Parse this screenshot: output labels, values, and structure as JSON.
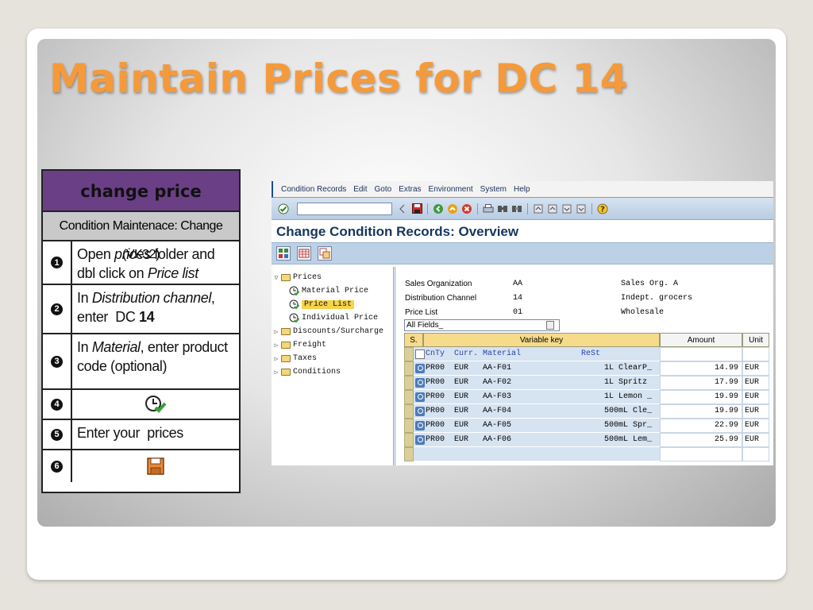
{
  "slide": {
    "title": "Maintain Prices for DC 14"
  },
  "steps": {
    "header": "change price",
    "subheader": "Condition Maintenace: Change (VK32)",
    "rows": [
      {
        "num": "1",
        "text_html": "Open <i>prices</i> folder and dbl click on <i>Price list</i>"
      },
      {
        "num": "2",
        "text_html": "In <i>Distribution channel</i>, enter &nbsp;DC <b>14</b>"
      },
      {
        "num": "3",
        "text_html": "In <i>Material</i>, enter product code (optional)"
      },
      {
        "num": "4",
        "icon": "execute-clock-check-icon"
      },
      {
        "num": "5",
        "text_html": "Enter your &nbsp;prices"
      },
      {
        "num": "6",
        "icon": "save-floppy-icon"
      }
    ]
  },
  "sap": {
    "menu": [
      "Condition Records",
      "Edit",
      "Goto",
      "Extras",
      "Environment",
      "System",
      "Help"
    ],
    "screen_title": "Change Condition Records: Overview",
    "tree": [
      {
        "label": "Prices",
        "type": "folder-open",
        "level": 0
      },
      {
        "label": "Material Price",
        "type": "item",
        "level": 1
      },
      {
        "label": "Price List",
        "type": "item",
        "level": 1,
        "selected": true
      },
      {
        "label": "Individual Price",
        "type": "item",
        "level": 1
      },
      {
        "label": "Discounts/Surcharge",
        "type": "folder",
        "level": 0
      },
      {
        "label": "Freight",
        "type": "folder",
        "level": 0
      },
      {
        "label": "Taxes",
        "type": "folder",
        "level": 0
      },
      {
        "label": "Conditions",
        "type": "folder",
        "level": 0
      }
    ],
    "fields": [
      {
        "label": "Sales Organization",
        "value": "AA",
        "desc": "Sales Org. A"
      },
      {
        "label": "Distribution Channel",
        "value": "14",
        "desc": "Indept. grocers"
      },
      {
        "label": "Price List",
        "value": "01",
        "desc": "Wholesale"
      }
    ],
    "layout_select": "All Fields_",
    "grid": {
      "col_s": "S.",
      "col_key": "Variable key",
      "col_amount": "Amount",
      "col_unit": "Unit",
      "subheader": {
        "cnty": "CnTy",
        "curr": "Curr.",
        "material": "Material",
        "rest": "ReSt"
      },
      "rows": [
        {
          "cnty": "PR00",
          "curr": "EUR",
          "material": "AA-F01",
          "desc": "1L ClearP_",
          "amount": "14.99",
          "unit": "EUR"
        },
        {
          "cnty": "PR00",
          "curr": "EUR",
          "material": "AA-F02",
          "desc": "1L Spritz",
          "amount": "17.99",
          "unit": "EUR"
        },
        {
          "cnty": "PR00",
          "curr": "EUR",
          "material": "AA-F03",
          "desc": "1L Lemon _",
          "amount": "19.99",
          "unit": "EUR"
        },
        {
          "cnty": "PR00",
          "curr": "EUR",
          "material": "AA-F04",
          "desc": "500mL Cle_",
          "amount": "19.99",
          "unit": "EUR"
        },
        {
          "cnty": "PR00",
          "curr": "EUR",
          "material": "AA-F05",
          "desc": "500mL Spr_",
          "amount": "22.99",
          "unit": "EUR"
        },
        {
          "cnty": "PR00",
          "curr": "EUR",
          "material": "AA-F06",
          "desc": "500mL Lem_",
          "amount": "25.99",
          "unit": "EUR"
        }
      ]
    }
  }
}
